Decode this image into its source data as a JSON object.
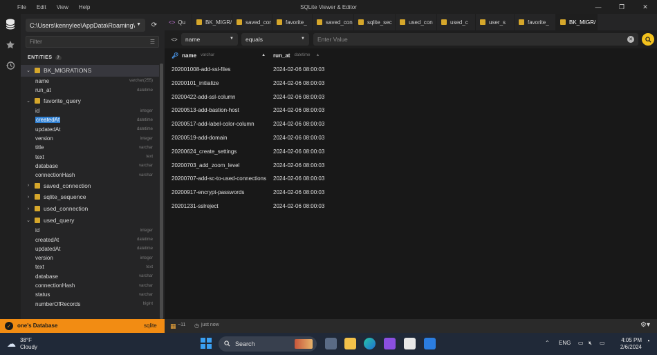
{
  "menu": [
    "File",
    "Edit",
    "View",
    "Help"
  ],
  "app_title": "SQLite Viewer & Editor",
  "window_controls": {
    "minimize": "—",
    "restore": "❐",
    "close": "✕"
  },
  "activity_icons": [
    "database-icon",
    "star-icon",
    "history-icon"
  ],
  "sidebar": {
    "connection_path": "C:\\Users\\kennylee\\AppData\\Roaming\\",
    "filter_placeholder": "Filter",
    "entities_label": "ENTITIES",
    "entities_count": "7",
    "tables": [
      {
        "name": "BK_MIGRATIONS",
        "expanded": true,
        "selected": true,
        "columns": [
          {
            "name": "name",
            "type": "varchar(255)"
          },
          {
            "name": "run_at",
            "type": "datetime"
          }
        ]
      },
      {
        "name": "favorite_query",
        "expanded": true,
        "columns": [
          {
            "name": "id",
            "type": "integer"
          },
          {
            "name": "createdAt",
            "type": "datetime",
            "highlight": true
          },
          {
            "name": "updatedAt",
            "type": "datetime"
          },
          {
            "name": "version",
            "type": "integer"
          },
          {
            "name": "title",
            "type": "varchar"
          },
          {
            "name": "text",
            "type": "text"
          },
          {
            "name": "database",
            "type": "varchar"
          },
          {
            "name": "connectionHash",
            "type": "varchar"
          }
        ]
      },
      {
        "name": "saved_connection",
        "expanded": false,
        "columns": []
      },
      {
        "name": "sqlite_sequence",
        "expanded": false,
        "columns": []
      },
      {
        "name": "used_connection",
        "expanded": false,
        "columns": []
      },
      {
        "name": "used_query",
        "expanded": true,
        "columns": [
          {
            "name": "id",
            "type": "integer"
          },
          {
            "name": "createdAt",
            "type": "datetime"
          },
          {
            "name": "updatedAt",
            "type": "datetime"
          },
          {
            "name": "version",
            "type": "integer"
          },
          {
            "name": "text",
            "type": "text"
          },
          {
            "name": "database",
            "type": "varchar"
          },
          {
            "name": "connectionHash",
            "type": "varchar"
          },
          {
            "name": "status",
            "type": "varchar"
          },
          {
            "name": "numberOfRecords",
            "type": "bigint"
          }
        ]
      }
    ]
  },
  "tabs": [
    {
      "label": "Qu",
      "kind": "query",
      "dirty": true
    },
    {
      "label": "BK_MIGR/",
      "kind": "table"
    },
    {
      "label": "saved_cor",
      "kind": "table"
    },
    {
      "label": "favorite_",
      "kind": "table"
    },
    {
      "label": "saved_con",
      "kind": "table"
    },
    {
      "label": "sqlite_sec",
      "kind": "table"
    },
    {
      "label": "used_con",
      "kind": "table"
    },
    {
      "label": "used_c",
      "kind": "table"
    },
    {
      "label": "user_s",
      "kind": "table"
    },
    {
      "label": "favorite_",
      "kind": "table"
    },
    {
      "label": "BK_MIGR/",
      "kind": "table",
      "active": true
    }
  ],
  "filter_bar": {
    "column": "name",
    "operator": "equals",
    "value_placeholder": "Enter Value"
  },
  "grid": {
    "columns": [
      {
        "name": "name",
        "type": "varchar",
        "sort": "▲",
        "key": true
      },
      {
        "name": "run_at",
        "type": "datetime",
        "sort": "▲"
      }
    ],
    "rows": [
      [
        "202001008-add-ssl-files",
        "2024-02-06 08:00:03"
      ],
      [
        "20200101_initialize",
        "2024-02-06 08:00:03"
      ],
      [
        "20200422-add-ssl-column",
        "2024-02-06 08:00:03"
      ],
      [
        "20200513-add-bastion-host",
        "2024-02-06 08:00:03"
      ],
      [
        "20200517-add-label-color-column",
        "2024-02-06 08:00:03"
      ],
      [
        "20200519-add-domain",
        "2024-02-06 08:00:03"
      ],
      [
        "20200624_create_settings",
        "2024-02-06 08:00:03"
      ],
      [
        "20200703_add_zoom_level",
        "2024-02-06 08:00:03"
      ],
      [
        "20200707-add-sc-to-used-connections",
        "2024-02-06 08:00:03"
      ],
      [
        "20200917-encrypt-passwords",
        "2024-02-06 08:00:03"
      ],
      [
        "20201231-sslreject",
        "2024-02-06 08:00:03"
      ]
    ]
  },
  "statusbar": {
    "database": "one's Database",
    "driver": "sqlite",
    "row_count": "~11",
    "last_run": "just now"
  },
  "taskbar": {
    "temperature": "38°F",
    "condition": "Cloudy",
    "search_label": "Search",
    "lang": "ENG",
    "time": "4:05 PM",
    "date": "2/6/2024"
  },
  "colors": {
    "accent": "#f28c13",
    "table_icon": "#d6a72b",
    "search_button": "#f2c11d",
    "key_icon": "#4fa3ff"
  }
}
